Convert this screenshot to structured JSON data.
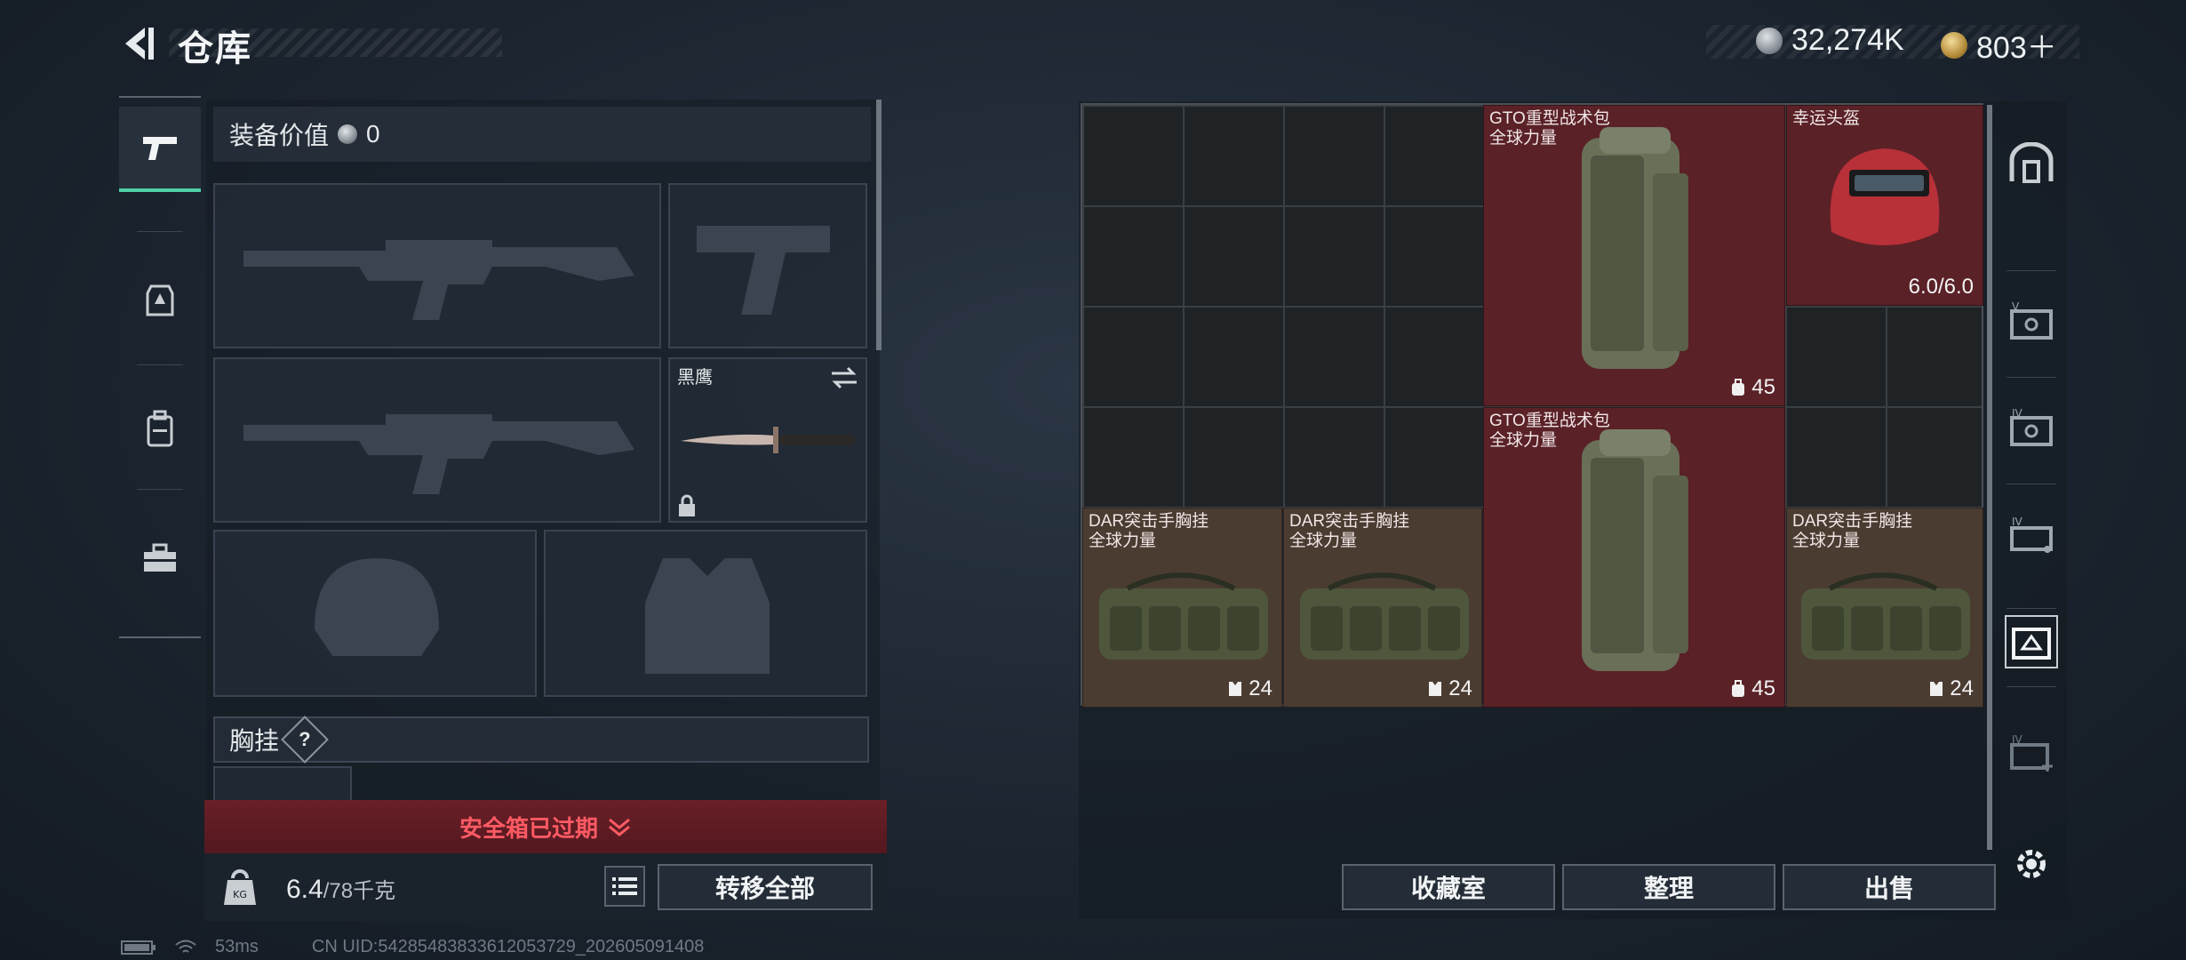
{
  "header": {
    "title": "仓库"
  },
  "currency": {
    "silver": "32,274K",
    "gold": "803＋"
  },
  "loadout": {
    "equip_value_label": "装备价值",
    "equip_value": "0",
    "melee": {
      "name": "黑鹰"
    },
    "chest_rig_label": "胸挂",
    "help": "?",
    "safebox_status": "安全箱已过期"
  },
  "weight": {
    "current": "6.4",
    "capacity": "/78千克"
  },
  "buttons": {
    "transfer_all": "转移全部",
    "collection": "收藏室",
    "sort": "整理",
    "sell": "出售"
  },
  "storage": {
    "items": [
      {
        "name": "GTO重型战术包",
        "sub": "全球力量",
        "qty": "45"
      },
      {
        "name": "幸运头盔",
        "qty": "6.0/6.0"
      },
      {
        "name": "GTO重型战术包",
        "sub": "全球力量",
        "qty": "45"
      },
      {
        "name": "DAR突击手胸挂",
        "sub": "全球力量",
        "qty": "24"
      },
      {
        "name": "DAR突击手胸挂",
        "sub": "全球力量",
        "qty": "24"
      },
      {
        "name": "DAR突击手胸挂",
        "sub": "全球力量",
        "qty": "24"
      }
    ]
  },
  "status": {
    "ping": "53ms",
    "uid": "CN UID:54285483833612053729_202605091408"
  }
}
